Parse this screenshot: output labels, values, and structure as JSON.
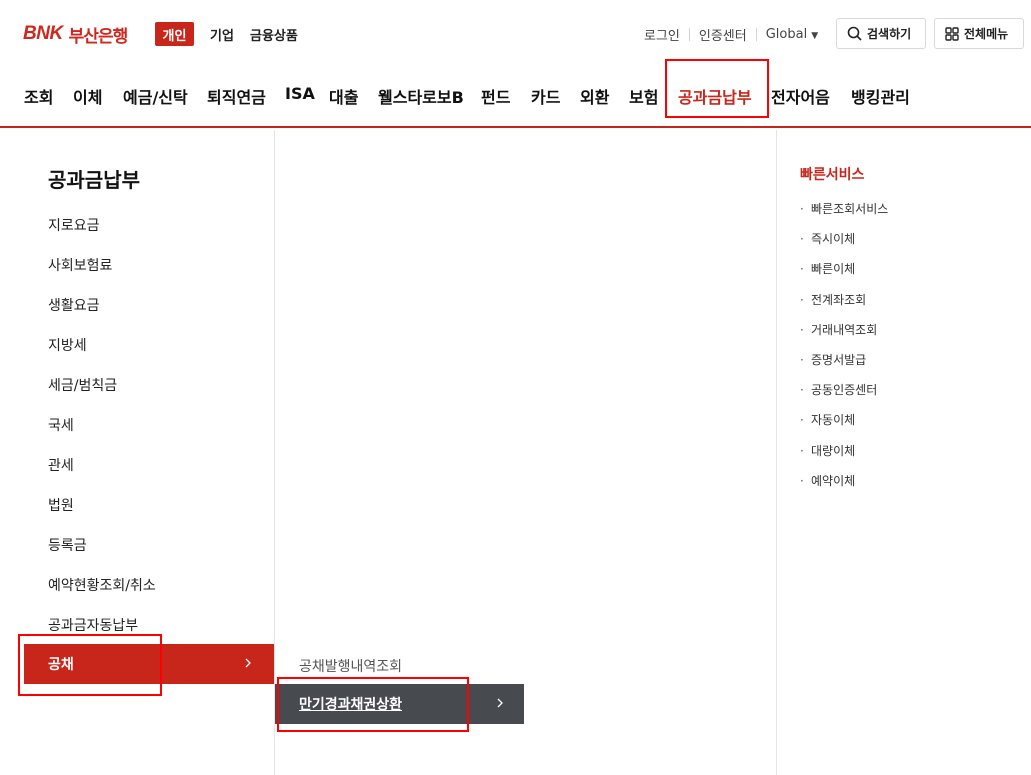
{
  "logo": {
    "bnk": "BNK",
    "bank": "부산은행"
  },
  "segments": {
    "personal": "개인",
    "corporate": "기업",
    "products": "금융상품"
  },
  "util": {
    "login": "로그인",
    "cert": "인증센터",
    "global": "Global"
  },
  "buttons": {
    "search": "검색하기",
    "all_menu": "전체메뉴"
  },
  "gnb": [
    "조회",
    "이체",
    "예금/신탁",
    "퇴직연금",
    "ISA",
    "대출",
    "웰스타로보B",
    "펀드",
    "카드",
    "외환",
    "보험",
    "공과금납부",
    "전자어음",
    "뱅킹관리"
  ],
  "sidebar": {
    "title": "공과금납부",
    "items": [
      "지로요금",
      "사회보험료",
      "생활요금",
      "지방세",
      "세금/범칙금",
      "국세",
      "관세",
      "법원",
      "등록금",
      "예약현황조회/취소",
      "공과금자동납부"
    ],
    "active": "공채"
  },
  "submenu": {
    "item": "공채발행내역조회",
    "active": "만기경과채권상환"
  },
  "quick": {
    "title": "빠른서비스",
    "items": [
      "빠른조회서비스",
      "즉시이체",
      "빠른이체",
      "전계좌조회",
      "거래내역조회",
      "증명서발급",
      "공동인증센터",
      "자동이체",
      "대량이체",
      "예약이체"
    ]
  },
  "colors": {
    "brand": "#c8261b",
    "highlight": "#ff0000",
    "subActive": "#474a4f"
  },
  "icons": {
    "search": "search-icon",
    "all_menu": "grid-icon",
    "chevron": "chevron-right-icon",
    "caret": "caret-down-icon"
  }
}
